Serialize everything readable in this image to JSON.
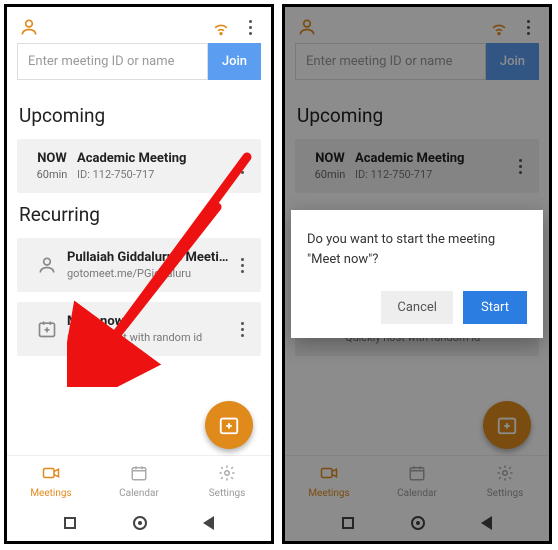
{
  "search": {
    "placeholder": "Enter meeting ID or name",
    "join": "Join"
  },
  "sections": {
    "upcoming": "Upcoming",
    "recurring": "Recurring"
  },
  "upcoming_item": {
    "badge": "NOW",
    "duration": "60min",
    "title": "Academic Meeting",
    "sub": "ID: 112-750-717"
  },
  "recurring1": {
    "title": "Pullaiah Giddaluru's Meeting",
    "sub": "gotomeet.me/PGiddaluru"
  },
  "recurring2": {
    "title": "Meet now",
    "sub": "Quickly host with random id"
  },
  "nav": {
    "meetings": "Meetings",
    "calendar": "Calendar",
    "settings": "Settings"
  },
  "dialog": {
    "text": "Do you want to start the meeting \"Meet now\"?",
    "cancel": "Cancel",
    "start": "Start"
  },
  "colors": {
    "accent": "#e08a1c",
    "primary": "#2b7de1",
    "join": "#5b9df0"
  }
}
